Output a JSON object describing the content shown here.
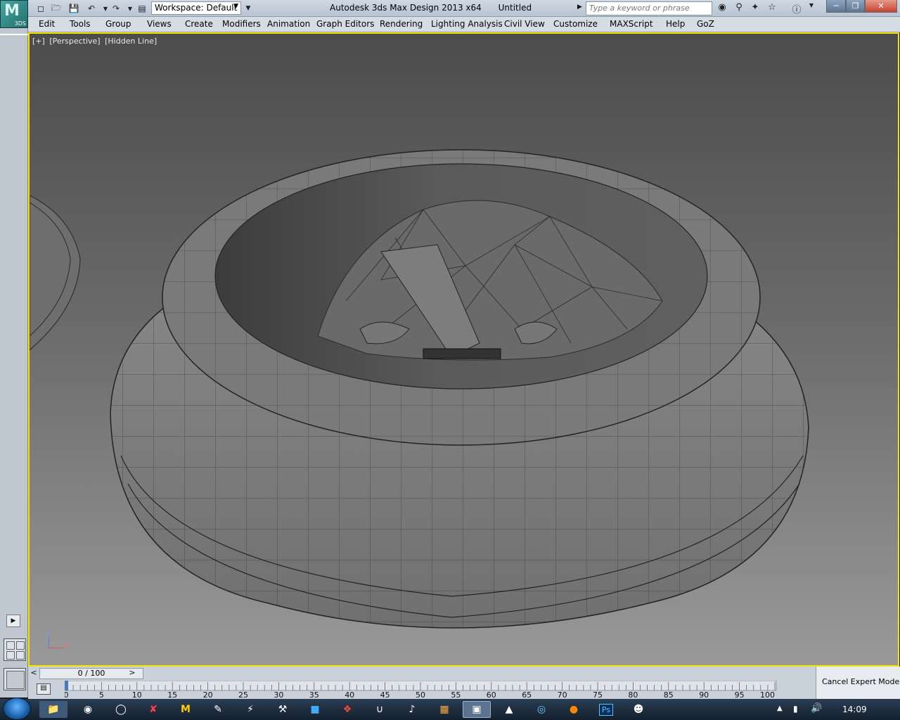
{
  "app": {
    "logo_text": "3DS",
    "title": "Autodesk 3ds Max Design 2013 x64",
    "document": "Untitled"
  },
  "quickaccess": {
    "workspace_value": "Workspace: Default"
  },
  "search": {
    "placeholder": "Type a keyword or phrase"
  },
  "menu": [
    "Edit",
    "Tools",
    "Group",
    "Views",
    "Create",
    "Modifiers",
    "Animation",
    "Graph Editors",
    "Rendering",
    "Lighting Analysis",
    "Civil View",
    "Customize",
    "MAXScript",
    "Help",
    "GoZ"
  ],
  "viewport": {
    "labels": [
      "[+]",
      "[Perspective]",
      "[Hidden Line]"
    ],
    "border_color": "#f3e400",
    "axis_z": "z",
    "axis_x": "x"
  },
  "timeline": {
    "slider_value": "0 / 100",
    "prev": "<",
    "next": ">",
    "ticks": [
      "0",
      "5",
      "10",
      "15",
      "20",
      "25",
      "30",
      "35",
      "40",
      "45",
      "50",
      "55",
      "60",
      "65",
      "70",
      "75",
      "80",
      "85",
      "90",
      "95",
      "100"
    ]
  },
  "status": {
    "cancel_expert": "Cancel Expert Mode"
  },
  "taskbar": {
    "time": "14:09",
    "apps": [
      "explorer-icon",
      "browser-icon",
      "chrome-icon",
      "x-app-icon",
      "m-app-icon",
      "paint-icon",
      "plug-icon",
      "tool-icon",
      "blue-app-icon",
      "red-app-icon",
      "u-app-icon",
      "audio-icon",
      "tiles-icon",
      "3dsmax-icon",
      "mudbox-icon",
      "circle-app-icon",
      "firefox-icon",
      "photoshop-icon",
      "user-icon"
    ],
    "ps_label": "Ps",
    "max_label": "M"
  }
}
